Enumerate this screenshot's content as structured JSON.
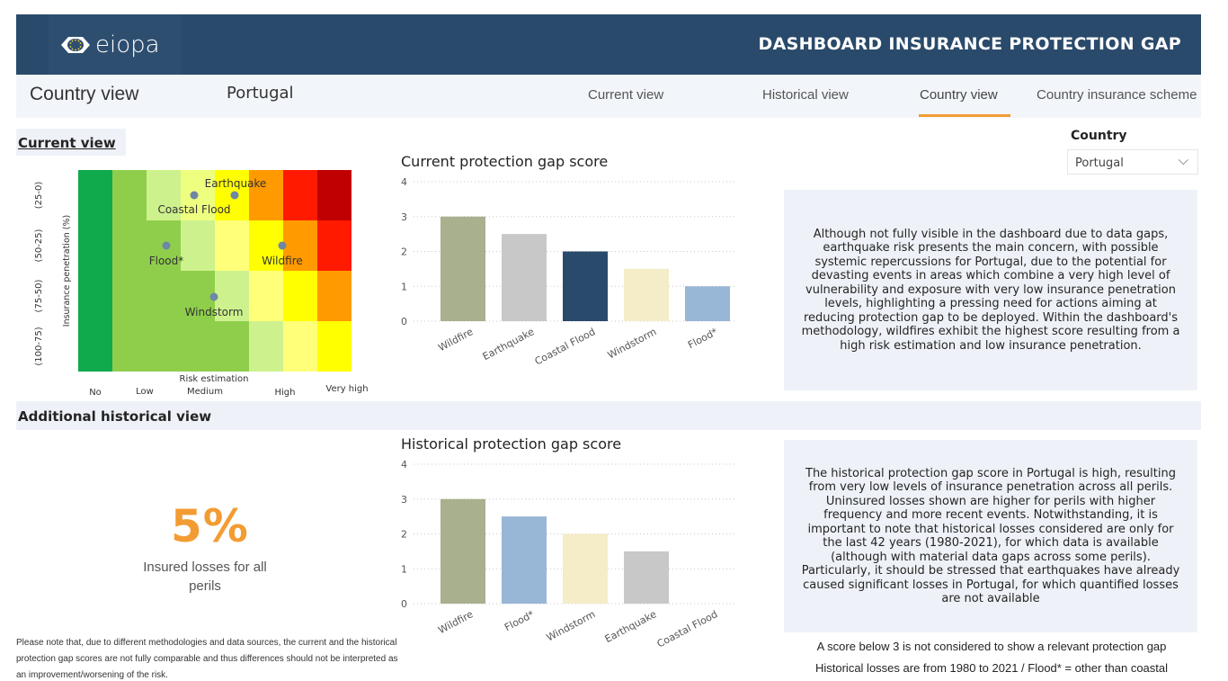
{
  "header": {
    "logo_text": "eiopa",
    "title": "DASHBOARD INSURANCE PROTECTION GAP"
  },
  "nav": {
    "page_title": "Country view",
    "country": "Portugal",
    "tabs": [
      "Current view",
      "Historical view",
      "Country view",
      "Country insurance scheme"
    ],
    "active_tab": "Country view",
    "accent_color": "#f39c33"
  },
  "current_section": {
    "heading": "Current view",
    "heatmap": {
      "ylabel": "Insurance penetration (%)",
      "xlabel": "Risk estimation",
      "y_ticks": [
        "(25-0)",
        "(50-25)",
        "(75-50)",
        "(100-75)"
      ],
      "x_ticks": [
        "No",
        "Low",
        "Medium",
        "High",
        "Very high"
      ],
      "perils": [
        "Earthquake",
        "Coastal Flood",
        "Flood*",
        "Wildfire",
        "Windstorm"
      ]
    },
    "chart_title": "Current protection gap score",
    "summary": "Although not fully visible in the dashboard due to data gaps, earthquake risk presents the main concern, with possible systemic repercussions for Portugal, due to the potential for devasting events in areas which combine a very high level of vulnerability and exposure with very low insurance penetration levels, highlighting a pressing need for actions aiming at reducing protection gap to be deployed. Within the dashboard's methodology, wildfires exhibit the highest score resulting from a high risk estimation and low insurance penetration."
  },
  "country_filter": {
    "label": "Country",
    "selected": "Portugal"
  },
  "historical_section": {
    "heading": "Additional historical view",
    "chart_title": "Historical protection gap score",
    "insured_pct": "5%",
    "insured_label": "Insured losses for all perils",
    "summary": "The historical protection gap score in Portugal is high, resulting from very low levels of insurance penetration across all perils. Uninsured losses shown are higher for perils with higher frequency and more recent events. Notwithstanding, it is important to note that historical losses considered are only for the last 42 years (1980-2021), for which data is available (although with material data gaps across some perils). Particularly, it should be stressed that earthquakes have already caused significant losses in Portugal, for which quantified losses are not available"
  },
  "footnote": "Please note that, due to different methodologies and data sources, the current and the historical protection gap scores are not fully comparable and thus differences should not be interpreted as an improvement/worsening of the risk.",
  "notes": {
    "score_note": "A score below 3 is not considered to show a relevant protection gap",
    "losses_note": "Historical losses are from 1980 to 2021 / Flood* = other than coastal"
  },
  "chart_data": [
    {
      "type": "bar",
      "title": "Current protection gap score",
      "categories": [
        "Wildfire",
        "Earthquake",
        "Coastal Flood",
        "Windstorm",
        "Flood*"
      ],
      "values": [
        3,
        2.5,
        2,
        1.5,
        1
      ],
      "colors": [
        "#a8b08e",
        "#c8c8c8",
        "#2a4a6b",
        "#f5ecc8",
        "#98b6d6"
      ],
      "ylim": [
        0,
        4
      ],
      "yticks": [
        0,
        1,
        2,
        3,
        4
      ],
      "grid": true
    },
    {
      "type": "bar",
      "title": "Historical protection gap score",
      "categories": [
        "Wildfire",
        "Flood*",
        "Windstorm",
        "Earthquake",
        "Coastal Flood"
      ],
      "values": [
        3,
        2.5,
        2,
        1.5,
        0
      ],
      "colors": [
        "#a8b08e",
        "#98b6d6",
        "#f5ecc8",
        "#c8c8c8",
        "#2a4a6b"
      ],
      "ylim": [
        0,
        4
      ],
      "yticks": [
        0,
        1,
        2,
        3,
        4
      ],
      "grid": true
    }
  ]
}
